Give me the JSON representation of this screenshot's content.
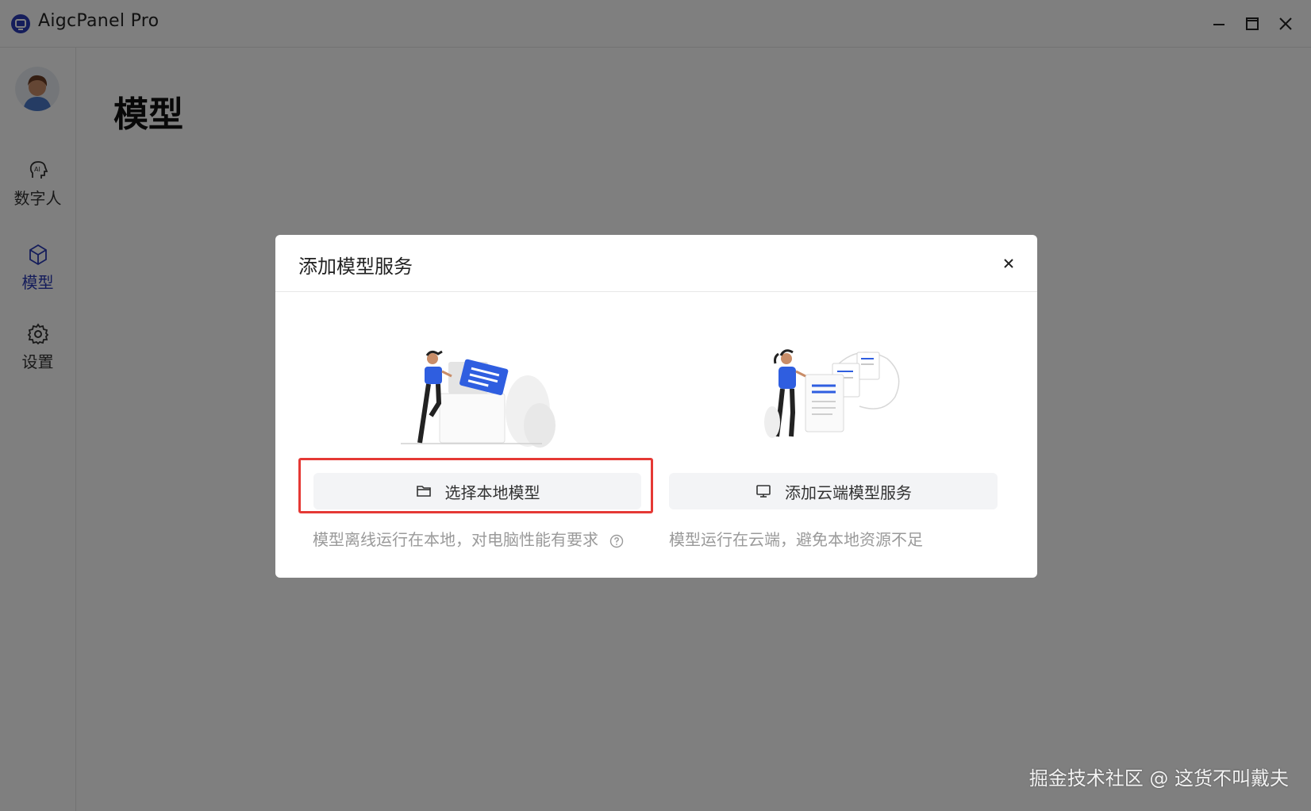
{
  "window": {
    "title": "AigcPanel Pro",
    "app_icon": "app-logo-icon",
    "controls": [
      "minimize-icon",
      "maximize-icon",
      "close-icon"
    ]
  },
  "sidebar": {
    "avatar_icon": "user-avatar",
    "items": [
      {
        "label": "数字人",
        "icon": "ai-head-icon",
        "active": false
      },
      {
        "label": "模型",
        "icon": "cube-icon",
        "active": true
      },
      {
        "label": "设置",
        "icon": "gear-icon",
        "active": false
      }
    ]
  },
  "main": {
    "title": "模型"
  },
  "modal": {
    "title": "添加模型服务",
    "close_icon": "close-icon",
    "options": [
      {
        "button_label": "选择本地模型",
        "button_icon": "folder-icon",
        "description": "模型离线运行在本地，对电脑性能有要求",
        "help_icon": "question-circle-icon",
        "highlighted": true
      },
      {
        "button_label": "添加云端模型服务",
        "button_icon": "monitor-icon",
        "description": "模型运行在云端，避免本地资源不足",
        "highlighted": false
      }
    ]
  },
  "watermark": "掘金技术社区 @ 这货不叫戴夫",
  "colors": {
    "accent": "#2a3bb7",
    "illustration_blue": "#2f5ee0",
    "highlight_red": "#e53935",
    "overlay": "rgba(0,0,0,0.5)"
  }
}
